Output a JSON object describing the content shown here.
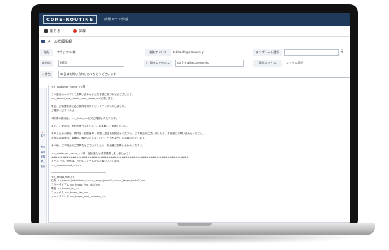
{
  "window": {
    "logo": "CORE-ROUTINE",
    "title": "新規メール作成"
  },
  "toolbar": {
    "close_label": "閉じる",
    "save_label": "保存"
  },
  "section": {
    "title": "メール詳細情報"
  },
  "fields": {
    "destination_label": "宛先",
    "destination_value": "サウジアラ 様",
    "dest_address_label": "宛先アドレス",
    "dest_address_value": "k-kbachi@careevn.jp",
    "template_label": "テンプレート選択",
    "sender_label": "差出人",
    "sender_value": "NEO",
    "sender_address_label": "差出人アドレス",
    "sender_address_value": "car7-mail@careevn.jp",
    "attachment_label": "添付ファイル",
    "attachment_value": "ファイル選択",
    "subject_label": "件名",
    "subject_value": "本日はお問い合わせありがとうございます",
    "body_label": "本文"
  },
  "side_buttons": [
    "差込",
    "項目",
    "削除",
    "挿入",
    "改行"
  ],
  "body_lines": [
    "<<_customer_name_>>様",
    "",
    "この度はカーペアルにお問い合わせいただき誠にありがとうございます。",
    "<<_tempo_me_scrollv_user_name_>>と申します。",
    "",
    "早速、ご希望条件に合う物件を何件かピックアップいたしました。",
    "ご確認くださいませ。",
    "",
    "      ※物件の詳細は、<<_fbdw_>>にてご確認いただけます。",
    "",
    "また、ご来店のご予約も承っております。お気軽にご連絡ください。",
    "",
    "お申し込みの際は、物件名・部屋番号・希望入居日をお知らせください。ご不明点がございましたら、お気軽にお問い合わせください。",
    "お申込書類等のご準備もご案内いたしますので、どうぞよろしくお願いいたします。",
    "",
    "その他、ご不明点やご質問などございましたら、お気軽にお問い合わせください。",
    "",
    "    <<_customer_name_>>様 一緒に楽しいお部屋探しをしましょう！",
    "########################################################################",
    "メールでのご返信はこちらのフォームからお願いいたします",
    "<<_assessment_url_>>",
    "",
    "────────────────────────────────────",
    "<<_tenpo_me_>>",
    "住所  <<_tenpo_todofuken_>><<_tenpo_jusho1_>><<_tenpo_jusho2_>>",
    "フリーダイアル  <<_tenpo_free_dial_>>",
    "電話  <<_tenpo_tel_>>",
    "ファックス  <<_tenpo_fax_>>",
    "メールアドレス  <<_tenpo_mail_address_>>",
    "────────────────────────────────────"
  ],
  "colors": {
    "titlebar": "#1f3a5a",
    "required": "#d9342b",
    "label_bg": "#eef1f6"
  }
}
